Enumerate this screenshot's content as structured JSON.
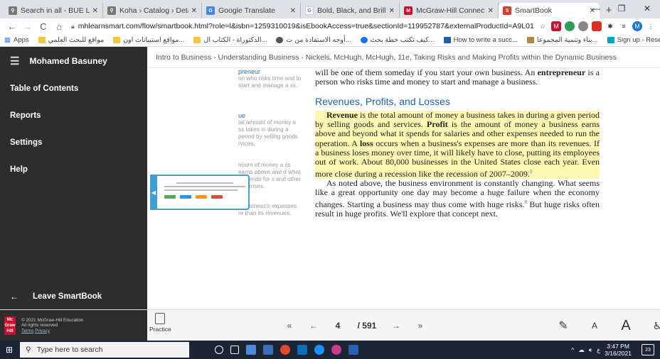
{
  "browser": {
    "tabs": [
      {
        "title": "Search in all - BUE Libr",
        "color": "#ffffff",
        "glyph": "⚲"
      },
      {
        "title": "Koha › Catalog › Details",
        "color": "#ffffff",
        "glyph": "⚲"
      },
      {
        "title": "Google Translate",
        "color": "#4285f4",
        "glyph": "G"
      },
      {
        "title": "Bold, Black, and Brillian",
        "color": "#ffffff",
        "glyph": "G"
      },
      {
        "title": "McGraw-Hill Connect",
        "color": "#c8102e",
        "glyph": "M"
      },
      {
        "title": "SmartBook",
        "color": "#e8362b",
        "glyph": "S"
      }
    ],
    "new_tab": "+",
    "window_controls": [
      "—",
      "❐",
      "✕"
    ],
    "nav": {
      "back": "←",
      "forward": "→",
      "reload": "C",
      "home": "⌂"
    },
    "url": "mhlearnsmart.com/flow/smartbook.html?role=l&isbn=1259310019&isEbookAccess=true&sectionId=119952787&externalProductId=A9L014...",
    "bookmarks": [
      {
        "label": "Apps"
      },
      {
        "label": "مواقع للبحث العلمي"
      },
      {
        "label": "مواقع استبيانات اون..."
      },
      {
        "label": "الدكتوراة - الكتاب ال..."
      },
      {
        "label": "أوجه الاستفادة من ت..."
      },
      {
        "label": "كيف تكتب خطة بحث..."
      },
      {
        "label": "How to write a succ..."
      },
      {
        "label": "بناء وتنمية المجموعا..."
      },
      {
        "label": "Sign up - Research..."
      }
    ],
    "more": "»"
  },
  "sidebar": {
    "user_name": "Mohamed Basuney",
    "items": [
      "Table of Contents",
      "Reports",
      "Settings",
      "Help"
    ],
    "leave": "Leave SmartBook"
  },
  "header": {
    "title": "Intro to Business - Understanding Business - Nickels, McHugh, McHugh, 11e, Taking Risks and Making Profits within the Dynamic Business"
  },
  "margin_notes": [
    {
      "head": "preneur",
      "text": "on who risks time and to start and manage a ss."
    },
    {
      "head": "ue",
      "text": "tal amount of money a ss takes in during a period by selling goods rvices."
    },
    {
      "head": "",
      "text": "nount of money a ss earns above and d what it spends for s and other expenses."
    },
    {
      "head": "",
      "text": "a business's expenses re than its revenues."
    }
  ],
  "book": {
    "intro": "will be one of them someday if you start your own business. An entrepreneur is a person who risks time and money to start and manage a business.",
    "intro_pre": "will be one of them someday if you start your own business. An ",
    "intro_term": "entrepreneur",
    "intro_post": " is a person who risks time and money to start and manage a business.",
    "heading": "Revenues, Profits, and Losses",
    "p1_term1": "Revenue",
    "p1_a": " is the total amount of money a business takes in during a given period by selling goods and services. ",
    "p1_term2": "Profit",
    "p1_b": " is the amount of money a business earns above and beyond what it spends for salaries and other expenses needed to run the operation. A ",
    "p1_term3": "loss",
    "p1_c": " occurs when a business's expenses are more than its revenues. If a business loses money over time, it will likely have to close, putting its employees out of work. About 80,000 businesses in the United States close each year. Even more close during a recession like the recession of 2007–2009.",
    "p1_sup": "5",
    "p2": "As noted above, the business environment is constantly changing. What seems like a great opportunity one day may become a huge failure when the economy changes. Starting a business may thus come with huge risks.",
    "p2_sup": "6",
    "p2_end": " But huge risks often result in huge profits. We'll explore that concept next."
  },
  "footer": {
    "copyright": "© 2021 McGraw-Hill Education",
    "rights": "All rights reserved",
    "terms": "Terms",
    "privacy": "Privacy",
    "logo": "Mc Graw Hill",
    "practice": "Practice",
    "first": "«",
    "prev": "←",
    "page": "4",
    "total": "/ 591",
    "next": "→",
    "last": "»",
    "font_small": "A",
    "font_large": "A"
  },
  "taskbar": {
    "search_placeholder": "Type here to search",
    "time": "3:47 PM",
    "date": "3/16/2021",
    "lang": "ع",
    "notifications": "23"
  }
}
